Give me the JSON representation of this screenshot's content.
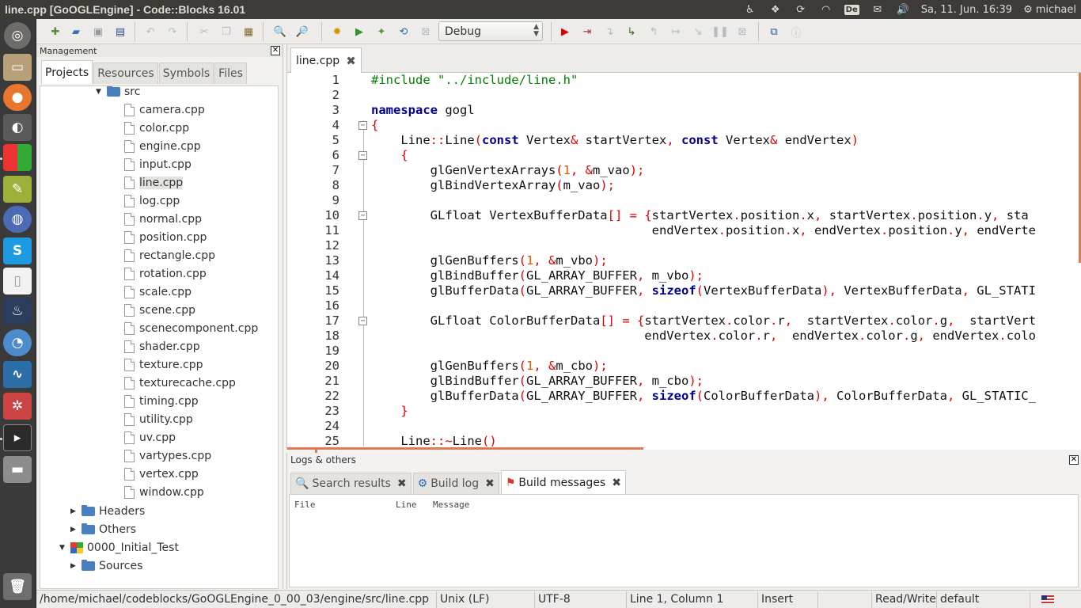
{
  "window": {
    "title": "line.cpp [GoOGLEngine] - Code::Blocks 16.01"
  },
  "tray": {
    "keyboard": "De",
    "datetime": "Sa, 11. Jun. 16:39",
    "user": "michael"
  },
  "toolbar": {
    "build_target": "Debug"
  },
  "management": {
    "title": "Management",
    "tabs": [
      "Projects",
      "Resources",
      "Symbols",
      "Files"
    ]
  },
  "tree": {
    "src_folder": "src",
    "files": [
      "camera.cpp",
      "color.cpp",
      "engine.cpp",
      "input.cpp",
      "line.cpp",
      "log.cpp",
      "normal.cpp",
      "position.cpp",
      "rectangle.cpp",
      "rotation.cpp",
      "scale.cpp",
      "scene.cpp",
      "scenecomponent.cpp",
      "shader.cpp",
      "texture.cpp",
      "texturecache.cpp",
      "timing.cpp",
      "utility.cpp",
      "uv.cpp",
      "vartypes.cpp",
      "vertex.cpp",
      "window.cpp"
    ],
    "headers": "Headers",
    "others": "Others",
    "project2": "0000_Initial_Test",
    "sources": "Sources"
  },
  "editor": {
    "tab": "line.cpp",
    "line_numbers": [
      "1",
      "2",
      "3",
      "4",
      "5",
      "6",
      "7",
      "8",
      "9",
      "10",
      "11",
      "12",
      "13",
      "14",
      "15",
      "16",
      "17",
      "18",
      "19",
      "20",
      "21",
      "22",
      "23",
      "24",
      "25"
    ]
  },
  "logs": {
    "title": "Logs & others",
    "tabs": [
      "Search results",
      "Build log",
      "Build messages"
    ],
    "columns": [
      "File",
      "Line",
      "Message"
    ]
  },
  "statusbar": {
    "path": "/home/michael/codeblocks/GoOGLEngine_0_00_03/engine/src/line.cpp",
    "eol": "Unix (LF)",
    "encoding": "UTF-8",
    "position": "Line 1, Column 1",
    "mode": "Insert",
    "access": "Read/Write",
    "scheme": "default"
  }
}
